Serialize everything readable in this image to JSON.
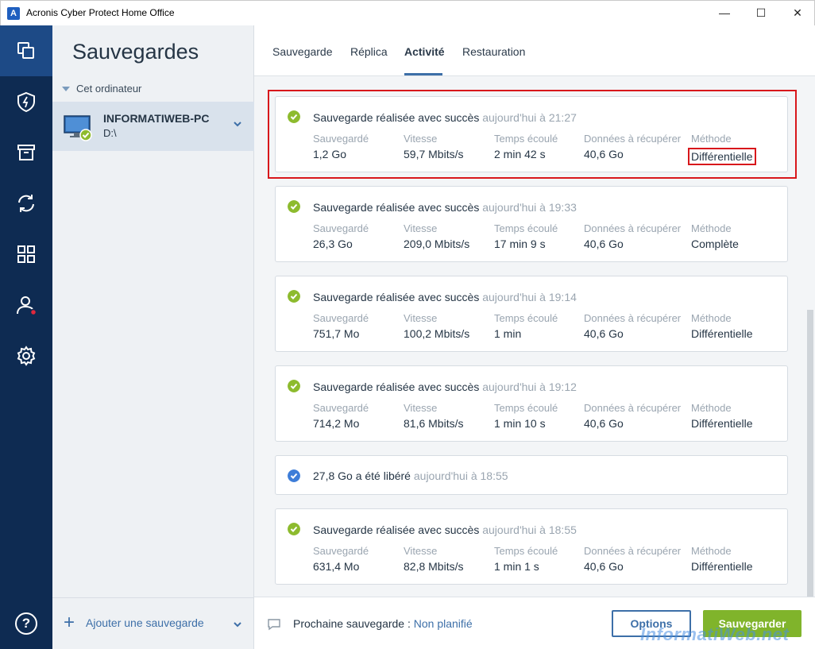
{
  "window": {
    "app_title": "Acronis Cyber Protect Home Office",
    "app_icon_letter": "A",
    "minimize": "—",
    "maximize": "☐",
    "close": "✕"
  },
  "rail": {
    "items": [
      {
        "icon": "backups-icon",
        "active": true
      },
      {
        "icon": "protection-shield-icon"
      },
      {
        "icon": "archive-icon"
      },
      {
        "icon": "sync-icon"
      },
      {
        "icon": "tools-grid-icon"
      },
      {
        "icon": "account-icon",
        "badge_color": "#e0283c"
      },
      {
        "icon": "settings-gear-icon"
      }
    ],
    "help_label": "?"
  },
  "sidebar": {
    "title": "Sauvegardes",
    "group_label": "Cet ordinateur",
    "backup": {
      "name": "INFORMATIWEB-PC",
      "drive": "D:\\"
    },
    "add_backup_label": "Ajouter une sauvegarde"
  },
  "tabs": [
    {
      "label": "Sauvegarde"
    },
    {
      "label": "Réplica"
    },
    {
      "label": "Activité",
      "active": true
    },
    {
      "label": "Restauration"
    }
  ],
  "column_labels": {
    "saved": "Sauvegardé",
    "speed": "Vitesse",
    "elapsed": "Temps écoulé",
    "recoverable": "Données à récupérer",
    "method": "Méthode"
  },
  "activity": [
    {
      "status": "success",
      "headline": "Sauvegarde réalisée avec succès",
      "when": "aujourd'hui à 21:27",
      "saved": "1,2 Go",
      "speed": "59,7 Mbits/s",
      "elapsed": "2 min 42 s",
      "recoverable": "40,6 Go",
      "method": "Différentielle"
    },
    {
      "status": "success",
      "headline": "Sauvegarde réalisée avec succès",
      "when": "aujourd'hui à 19:33",
      "saved": "26,3 Go",
      "speed": "209,0 Mbits/s",
      "elapsed": "17 min 9 s",
      "recoverable": "40,6 Go",
      "method": "Complète"
    },
    {
      "status": "success",
      "headline": "Sauvegarde réalisée avec succès",
      "when": "aujourd'hui à 19:14",
      "saved": "751,7 Mo",
      "speed": "100,2 Mbits/s",
      "elapsed": "1 min",
      "recoverable": "40,6 Go",
      "method": "Différentielle"
    },
    {
      "status": "success",
      "headline": "Sauvegarde réalisée avec succès",
      "when": "aujourd'hui à 19:12",
      "saved": "714,2 Mo",
      "speed": "81,6 Mbits/s",
      "elapsed": "1 min 10 s",
      "recoverable": "40,6 Go",
      "method": "Différentielle"
    },
    {
      "status": "info",
      "headline": "27,8 Go a été libéré",
      "when": "aujourd'hui à 18:55"
    },
    {
      "status": "success",
      "headline": "Sauvegarde réalisée avec succès",
      "when": "aujourd'hui à 18:55",
      "saved": "631,4 Mo",
      "speed": "82,8 Mbits/s",
      "elapsed": "1 min 1 s",
      "recoverable": "40,6 Go",
      "method": "Différentielle"
    }
  ],
  "footer": {
    "next_label": "Prochaine sauvegarde :",
    "next_value": "Non planifié",
    "options_label": "Options",
    "save_label": "Sauvegarder"
  },
  "colors": {
    "success": "#8dbb2e",
    "info": "#3d7dd8",
    "accent": "#3d6fa8",
    "save_button": "#80b42b",
    "rail": "#0e2b52"
  },
  "watermark": "InformatiWeb.net"
}
